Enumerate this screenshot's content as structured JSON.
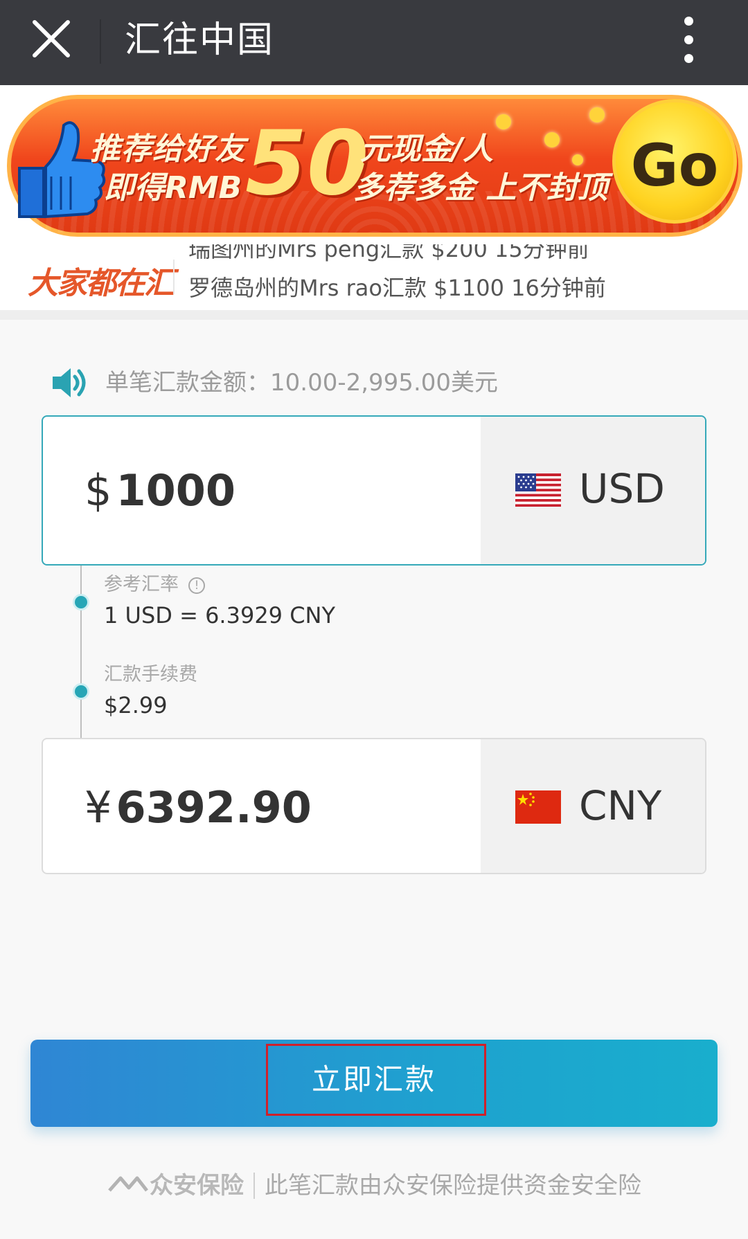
{
  "topbar": {
    "title": "汇往中国"
  },
  "banner": {
    "line1": "推荐给好友",
    "line2": "即得RMB",
    "big_number": "50",
    "line3": "元现金/人",
    "line4": "多荐多金 上不封顶",
    "go_label": "Go",
    "colors": {
      "background": "#f0461c",
      "accent": "#ffe27a"
    }
  },
  "ticker": {
    "logo_text": "大家都在汇",
    "items": [
      "瑞图州的Mrs peng汇款 $200 15分钟前",
      "罗德岛州的Mrs rao汇款 $1100 16分钟前"
    ]
  },
  "notice": {
    "text": "单笔汇款金额：10.00-2,995.00美元"
  },
  "from": {
    "symbol": "$",
    "amount": "1000",
    "currency": "USD",
    "flag_icon": "us-flag-icon",
    "accent": "#35a9b9"
  },
  "rate": {
    "label": "参考汇率",
    "value": "1 USD = 6.3929 CNY"
  },
  "fee": {
    "label": "汇款手续费",
    "value": "$2.99"
  },
  "to": {
    "symbol": "¥",
    "amount": "6392.90",
    "currency": "CNY",
    "flag_icon": "cn-flag-icon"
  },
  "submit": {
    "label": "立即汇款",
    "color": "#1ea2cf"
  },
  "footer": {
    "brand": "众安保险",
    "text": "此笔汇款由众安保险提供资金安全险"
  }
}
